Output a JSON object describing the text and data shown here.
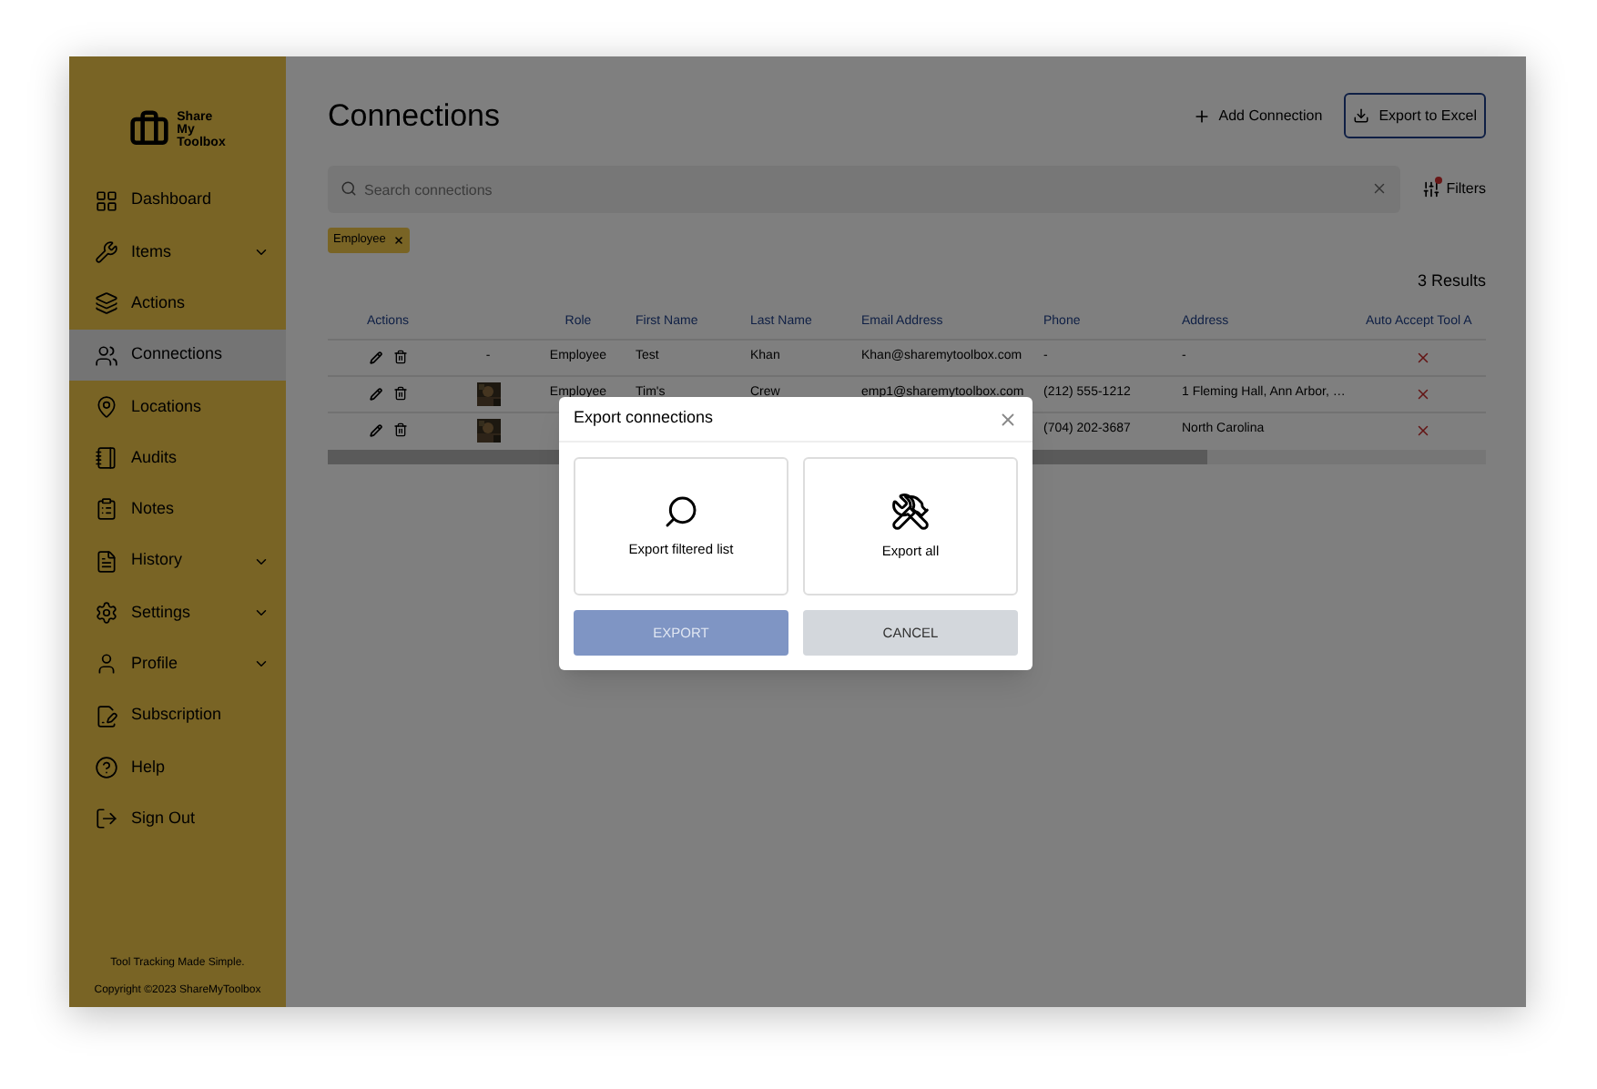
{
  "logo": {
    "lines": [
      "Share",
      "My",
      "Toolbox"
    ]
  },
  "sidebar": {
    "items": [
      {
        "label": "Dashboard",
        "kind": "link",
        "selected": false
      },
      {
        "label": "Items",
        "kind": "group",
        "selected": false
      },
      {
        "label": "Actions",
        "kind": "link",
        "selected": false
      },
      {
        "label": "Connections",
        "kind": "link",
        "selected": true
      },
      {
        "label": "Locations",
        "kind": "link",
        "selected": false
      },
      {
        "label": "Audits",
        "kind": "link",
        "selected": false
      },
      {
        "label": "Notes",
        "kind": "link",
        "selected": false
      },
      {
        "label": "History",
        "kind": "group",
        "selected": false
      },
      {
        "label": "Settings",
        "kind": "group",
        "selected": false
      },
      {
        "label": "Profile",
        "kind": "group",
        "selected": false
      },
      {
        "label": "Subscription",
        "kind": "link",
        "selected": false
      },
      {
        "label": "Help",
        "kind": "link",
        "selected": false
      },
      {
        "label": "Sign Out",
        "kind": "link",
        "selected": false
      }
    ],
    "tagline": "Tool Tracking Made Simple.",
    "copyright": "Copyright ©2023 ShareMyToolbox"
  },
  "page": {
    "title": "Connections",
    "add_button": "Add Connection",
    "export_button": "Export to Excel"
  },
  "search": {
    "placeholder": "Search connections",
    "filters_label": "Filters",
    "filters_active": true
  },
  "chips": [
    {
      "label": "Employee"
    }
  ],
  "results": "3 Results",
  "table": {
    "columns": [
      "Actions",
      "",
      "Role",
      "First Name",
      "Last Name",
      "Email Address",
      "Phone",
      "Address",
      "Auto Accept Tool A"
    ],
    "rows": [
      {
        "photo": false,
        "cells": [
          null,
          "-",
          "Employee",
          "Test",
          "Khan",
          "Khan@sharemytoolbox.com",
          "-",
          "-"
        ],
        "auto_accept": false
      },
      {
        "photo": true,
        "cells": [
          null,
          null,
          "Employee",
          "Tim's",
          "Crew",
          "emp1@sharemytoolbox.com",
          "(212) 555-1212",
          "1 Fleming Hall, Ann Arbor, …"
        ],
        "auto_accept": false
      },
      {
        "photo": true,
        "cells": [
          null,
          null,
          null,
          null,
          null,
          null,
          "(704) 202-3687",
          "North Carolina"
        ],
        "auto_accept": false
      }
    ]
  },
  "dialog": {
    "title": "Export connections",
    "options": [
      {
        "label": "Export filtered list",
        "kind": "filtered",
        "selected": false
      },
      {
        "label": "Export all",
        "kind": "all",
        "selected": false
      }
    ],
    "export_button": "EXPORT",
    "export_disabled": true,
    "cancel_button": "CANCEL"
  }
}
